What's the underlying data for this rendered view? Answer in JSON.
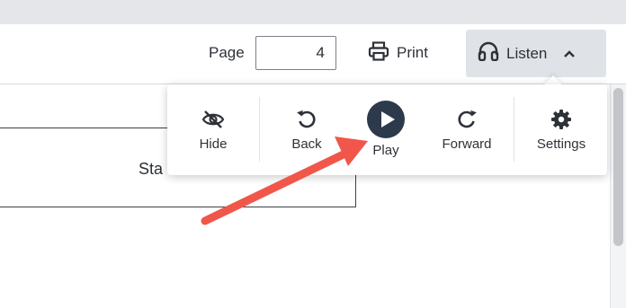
{
  "toolbar": {
    "page_label": "Page",
    "page_value": "4",
    "print_label": "Print",
    "listen_label": "Listen"
  },
  "document": {
    "text_fragment": "Sta"
  },
  "listen_popup": {
    "hide_label": "Hide",
    "back_label": "Back",
    "play_label": "Play",
    "forward_label": "Forward",
    "settings_label": "Settings"
  },
  "colors": {
    "accent_dark": "#2c3a4b",
    "annotation_arrow": "#f0574a",
    "listen_bg": "#dfe3e8"
  },
  "icons": [
    "printer-icon",
    "headphones-icon",
    "chevron-up-icon",
    "eye-slash-icon",
    "rewind-icon",
    "play-icon",
    "forward-icon",
    "gear-icon"
  ]
}
